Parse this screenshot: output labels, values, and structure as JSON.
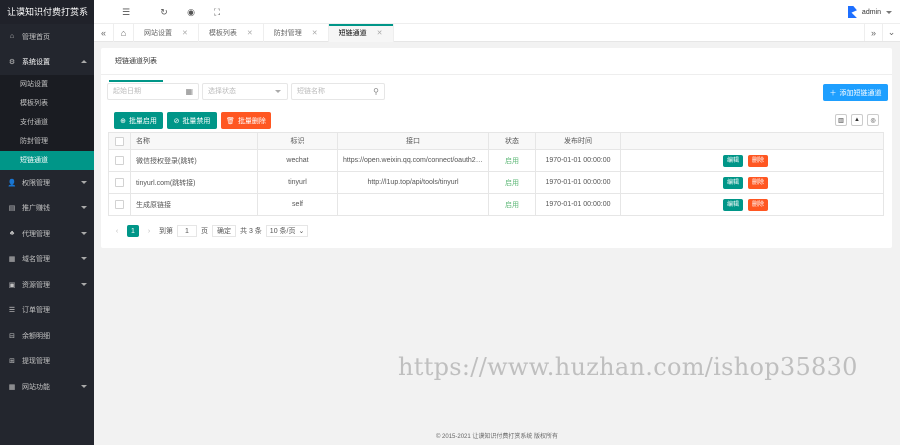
{
  "app_title": "让谟知识付费打赏系",
  "sidebar": {
    "items": [
      {
        "label": "管理首页",
        "icon": "home-icon",
        "arrow": false
      },
      {
        "label": "系统设置",
        "icon": "gear-icon",
        "arrow": "up"
      }
    ],
    "sub_items": [
      "网站设置",
      "模板列表",
      "支付通道",
      "防封管理",
      "短链通道"
    ],
    "active_sub": 4,
    "items_after": [
      {
        "label": "权限管理",
        "icon": "user-icon"
      },
      {
        "label": "推广赚钱",
        "icon": "money-icon"
      },
      {
        "label": "代理管理",
        "icon": "agent-icon"
      },
      {
        "label": "域名管理",
        "icon": "domain-icon"
      },
      {
        "label": "资源管理",
        "icon": "resource-icon"
      },
      {
        "label": "订单管理",
        "icon": "order-icon"
      },
      {
        "label": "余额明细",
        "icon": "balance-icon"
      },
      {
        "label": "提现管理",
        "icon": "withdraw-icon"
      },
      {
        "label": "网站功能",
        "icon": "grid-icon"
      }
    ]
  },
  "header": {
    "user": "admin"
  },
  "tabs": [
    {
      "label": "网站设置"
    },
    {
      "label": "模板列表"
    },
    {
      "label": "防封管理"
    },
    {
      "label": "短链通道",
      "active": true
    }
  ],
  "card": {
    "tab_label": "短链通道列表",
    "filters": {
      "start_placeholder": "起始日期",
      "status_placeholder": "选择状态",
      "search_placeholder": "短链名称"
    },
    "add_label": "添加短链通道",
    "batch": {
      "enable": "批量启用",
      "disable": "批量禁用",
      "delete": "批量删除"
    },
    "columns": [
      "名称",
      "标识",
      "接口",
      "状态",
      "发布时间",
      ""
    ],
    "rows": [
      {
        "name": "微信授权登录(跳转)",
        "id": "wechat",
        "api": "https://open.weixin.qq.com/connect/oauth2/authoriz...",
        "status": "启用",
        "time": "1970-01-01 00:00:00"
      },
      {
        "name": "tinyurl.com(跳转接)",
        "id": "tinyurl",
        "api": "http://l1up.top/api/tools/tinyurl",
        "status": "启用",
        "time": "1970-01-01 00:00:00"
      },
      {
        "name": "生成原链接",
        "id": "self",
        "api": "",
        "status": "启用",
        "time": "1970-01-01 00:00:00"
      }
    ],
    "actions": {
      "edit": "编辑",
      "delete": "删除"
    },
    "pager": {
      "current": "1",
      "goto_label": "到第",
      "goto_value": "1",
      "page_unit": "页",
      "confirm": "确定",
      "total": "共 3 条",
      "per_page": "10 条/页"
    }
  },
  "watermark": "https://www.huzhan.com/ishop35830",
  "footer": "© 2015-2021 让谟知识付费打赏系统 版权所有",
  "colors": {
    "accent": "#009688",
    "blue": "#1e9fff",
    "orange": "#ff5722",
    "sidebar": "#23262e"
  }
}
